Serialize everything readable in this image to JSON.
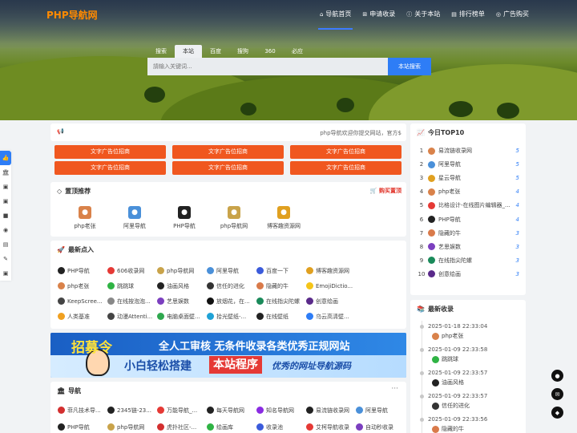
{
  "brand": {
    "logo": "PHP导航网"
  },
  "nav": [
    {
      "label": "导航首页",
      "icon": "home-icon",
      "glyph": "⌂",
      "active": true
    },
    {
      "label": "申请收录",
      "icon": "plus-square-icon",
      "glyph": "⊞",
      "active": false
    },
    {
      "label": "关于本站",
      "icon": "info-icon",
      "glyph": "ⓘ",
      "active": false
    },
    {
      "label": "排行榜单",
      "icon": "chart-icon",
      "glyph": "▤",
      "active": false
    },
    {
      "label": "广告购买",
      "icon": "eye-icon",
      "glyph": "◎",
      "active": false
    }
  ],
  "search": {
    "tabs": [
      "搜索",
      "本站",
      "百度",
      "搜狗",
      "360",
      "必应"
    ],
    "active_tab": "本站",
    "placeholder": "請输入关键词...",
    "button": "本站搜索"
  },
  "left_sidebar": {
    "icons": [
      "thumb-up-icon",
      "bank-icon",
      "id-card-icon",
      "id-card-icon",
      "video-icon",
      "cube-icon",
      "ticket-icon",
      "wrench-icon",
      "id-card-icon"
    ],
    "glyphs": [
      "👍",
      "🏛",
      "▣",
      "▣",
      "■",
      "◉",
      "▤",
      "✎",
      "▣"
    ]
  },
  "notice": {
    "text": "php导航欢迎你提交网站，官方$",
    "icon": "megaphone-icon",
    "glyph": "📢"
  },
  "ads": [
    "文字广告位招商",
    "文字广告位招商",
    "文字广告位招商",
    "文字广告位招商",
    "文字广告位招商",
    "文字广告位招商"
  ],
  "recommended": {
    "title": "置顶推荐",
    "icon": "diamond-icon",
    "buy_label": "购买置顶",
    "items": [
      {
        "name": "php老张",
        "color": "#d9824a"
      },
      {
        "name": "阿里导航",
        "color": "#4a90d9"
      },
      {
        "name": "PHP导航",
        "color": "#222222"
      },
      {
        "name": "php导航网",
        "color": "#c9a34a"
      },
      {
        "name": "博客趣资源网",
        "color": "#e0a020"
      }
    ]
  },
  "latest": {
    "title": "最新点入",
    "icon": "rocket-icon",
    "items": [
      {
        "name": "PHP导航",
        "color": "#222222"
      },
      {
        "name": "606收录网",
        "color": "#e53935"
      },
      {
        "name": "php导航网",
        "color": "#c9a34a"
      },
      {
        "name": "阿里导航",
        "color": "#4a90d9"
      },
      {
        "name": "百度一下",
        "color": "#3b5bdb"
      },
      {
        "name": "博客趣资源网",
        "color": "#e0a020"
      },
      {
        "name": "php老张",
        "color": "#d9824a"
      },
      {
        "name": "跳跳球",
        "color": "#2fb344"
      },
      {
        "name": "油画风格",
        "color": "#222222"
      },
      {
        "name": "信任的进化",
        "color": "#333333"
      },
      {
        "name": "隐藏的牛",
        "color": "#d97a4a"
      },
      {
        "name": "EmojiDictio...",
        "color": "#f5c518"
      },
      {
        "name": "KeepScree...",
        "color": "#444444"
      },
      {
        "name": "在线按泡泡...",
        "color": "#888888"
      },
      {
        "name": "艺思娱数",
        "color": "#7b3fbf"
      },
      {
        "name": "放烟花，在...",
        "color": "#111111"
      },
      {
        "name": "在线指尖陀螺",
        "color": "#1a8a5a"
      },
      {
        "name": "创意绘画",
        "color": "#5a2a8a"
      },
      {
        "name": "人类基准",
        "color": "#f0a020"
      },
      {
        "name": "动漫Attenti...",
        "color": "#444444"
      },
      {
        "name": "电脑桌面壁...",
        "color": "#2fa84f"
      },
      {
        "name": "拾光壁纸-...",
        "color": "#1fa2d6"
      },
      {
        "name": "在线壁纸",
        "color": "#222222"
      },
      {
        "name": "乌云高清壁...",
        "color": "#2e7df6"
      }
    ]
  },
  "banner": {
    "line1a": "招募令",
    "line1b": "全人工审核  无条件收录各类优秀正规网站",
    "line2a": "小白轻松搭建",
    "line2b": "本站程序",
    "line2c": "优秀的网址导航源码"
  },
  "navsection": {
    "title": "导航",
    "icon": "bank-icon",
    "more": "···",
    "items": [
      {
        "name": "菲凡技术导...",
        "color": "#d32f2f"
      },
      {
        "name": "2345链-23...",
        "color": "#222222"
      },
      {
        "name": "万能导航_...",
        "color": "#e53935"
      },
      {
        "name": "每天导航网",
        "color": "#222222"
      },
      {
        "name": "知名导航网",
        "color": "#8a2be2"
      },
      {
        "name": "易流链收录网",
        "color": "#222222"
      },
      {
        "name": "阿里导航",
        "color": "#4a90d9"
      },
      {
        "name": "PHP导航",
        "color": "#222222"
      },
      {
        "name": "php导航网",
        "color": "#c9a34a"
      },
      {
        "name": "虎扑社区-...",
        "color": "#d32f2f"
      },
      {
        "name": "绘画库",
        "color": "#2fb344"
      },
      {
        "name": "收录池",
        "color": "#3b5bdb"
      },
      {
        "name": "艾柯导航收录",
        "color": "#e53935"
      },
      {
        "name": "自动秒收录",
        "color": "#7b3fbf"
      }
    ]
  },
  "top10": {
    "title": "今日TOP10",
    "icon": "trend-icon",
    "rows": [
      {
        "rank": "1",
        "name": "易流链收录网",
        "count": "5",
        "color": "#d9824a"
      },
      {
        "rank": "2",
        "name": "阿里导航",
        "count": "5",
        "color": "#4a90d9"
      },
      {
        "rank": "3",
        "name": "星云导航",
        "count": "5",
        "color": "#e0a020"
      },
      {
        "rank": "4",
        "name": "php老张",
        "count": "4",
        "color": "#d9824a"
      },
      {
        "rank": "5",
        "name": "比格设计-在线图片编辑器_...",
        "count": "4",
        "color": "#e53935"
      },
      {
        "rank": "6",
        "name": "PHP导航",
        "count": "4",
        "color": "#222222"
      },
      {
        "rank": "7",
        "name": "隐藏的牛",
        "count": "3",
        "color": "#d97a4a"
      },
      {
        "rank": "8",
        "name": "艺思娱数",
        "count": "3",
        "color": "#7b3fbf"
      },
      {
        "rank": "9",
        "name": "在线指尖陀螺",
        "count": "3",
        "color": "#1a8a5a"
      },
      {
        "rank": "10",
        "name": "创意绘画",
        "count": "3",
        "color": "#5a2a8a"
      }
    ]
  },
  "newinc": {
    "title": "最新收录",
    "icon": "book-icon",
    "items": [
      {
        "date": "2025-01-18 22:33:04",
        "name": "php老张",
        "color": "#d9824a"
      },
      {
        "date": "2025-01-09 22:33:58",
        "name": "跳跳球",
        "color": "#2fb344"
      },
      {
        "date": "2025-01-09 22:33:57",
        "name": "油画风格",
        "color": "#222222"
      },
      {
        "date": "2025-01-09 22:33:57",
        "name": "信任的进化",
        "color": "#333333"
      },
      {
        "date": "2025-01-09 22:33:56",
        "name": "隐藏的牛",
        "color": "#d97a4a"
      }
    ]
  },
  "float": [
    {
      "icon": "message-icon",
      "glyph": "●"
    },
    {
      "icon": "mail-icon",
      "glyph": "✉"
    },
    {
      "icon": "qq-icon",
      "glyph": "◆"
    }
  ]
}
